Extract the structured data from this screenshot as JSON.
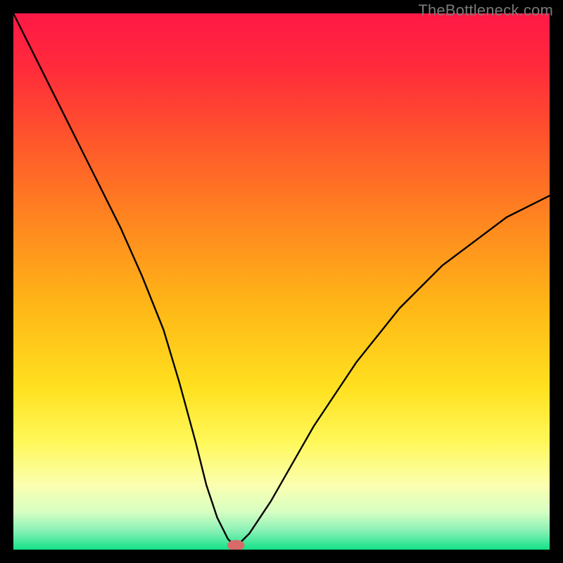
{
  "watermark": "TheBottleneck.com",
  "chart_data": {
    "type": "line",
    "title": "",
    "xlabel": "",
    "ylabel": "",
    "xlim": [
      0,
      100
    ],
    "ylim": [
      0,
      100
    ],
    "grid": false,
    "legend": false,
    "background_gradient": {
      "stops": [
        {
          "pos": 0.0,
          "color": "#ff1946"
        },
        {
          "pos": 0.1,
          "color": "#ff2a3b"
        },
        {
          "pos": 0.25,
          "color": "#ff5a2a"
        },
        {
          "pos": 0.4,
          "color": "#ff8a1f"
        },
        {
          "pos": 0.55,
          "color": "#ffb817"
        },
        {
          "pos": 0.7,
          "color": "#ffe120"
        },
        {
          "pos": 0.8,
          "color": "#fff85a"
        },
        {
          "pos": 0.88,
          "color": "#fbffb0"
        },
        {
          "pos": 0.93,
          "color": "#d6ffc2"
        },
        {
          "pos": 0.965,
          "color": "#88f0b5"
        },
        {
          "pos": 1.0,
          "color": "#14e288"
        }
      ]
    },
    "series": [
      {
        "name": "bottleneck-curve",
        "color": "#000000",
        "x": [
          0,
          4,
          8,
          12,
          16,
          20,
          24,
          28,
          31,
          34,
          36,
          38,
          40,
          41,
          42,
          44,
          48,
          52,
          56,
          60,
          64,
          68,
          72,
          76,
          80,
          84,
          88,
          92,
          96,
          100
        ],
        "y": [
          100,
          92,
          84,
          76,
          68,
          60,
          51,
          41,
          31,
          20,
          12,
          6,
          2,
          1,
          1,
          3,
          9,
          16,
          23,
          29,
          35,
          40,
          45,
          49,
          53,
          56,
          59,
          62,
          64,
          66
        ]
      }
    ],
    "marker": {
      "name": "optimal-point",
      "x": 41.5,
      "y": 0.8,
      "color": "#d96a6a",
      "rx": 1.6,
      "ry": 1.0
    }
  }
}
